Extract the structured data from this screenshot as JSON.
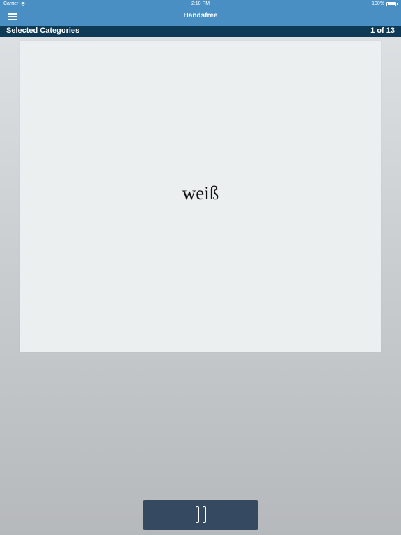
{
  "status_bar": {
    "carrier": "Carrier",
    "time": "2:10 PM",
    "battery": "100%"
  },
  "nav": {
    "title": "Handsfree",
    "menu_icon": "hamburger-menu-icon"
  },
  "category_bar": {
    "title": "Selected Categories",
    "position": "1 of 13"
  },
  "card": {
    "word": "weiß"
  },
  "controls": {
    "pause_icon": "pause-icon"
  },
  "colors": {
    "nav_blue": "#4a8fc4",
    "category_bar": "#0f3a55",
    "pause_button": "#354a60"
  }
}
